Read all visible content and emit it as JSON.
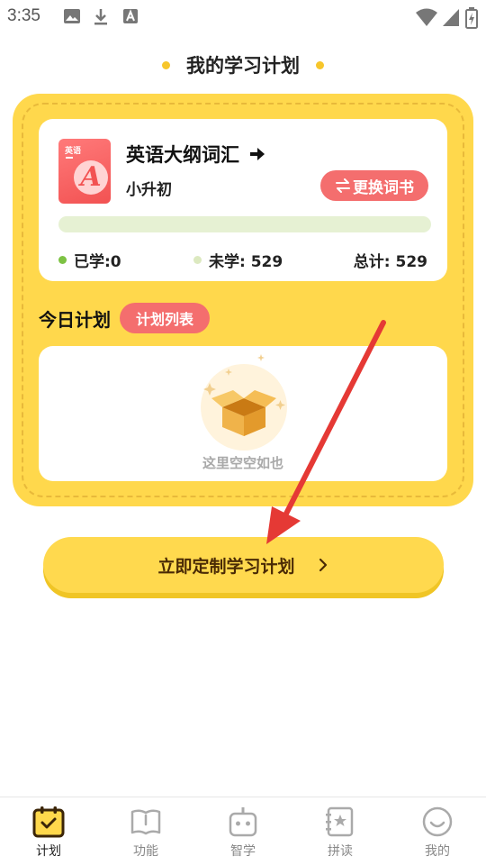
{
  "status_bar": {
    "time": "3:35"
  },
  "header": {
    "title": "我的学习计划"
  },
  "book": {
    "cover_label": "英语",
    "cover_letter": "A",
    "name": "英语大纲词汇",
    "level": "小升初",
    "change_label": "更换词书",
    "progress_fraction": 0,
    "learned": "已学:0",
    "unlearned": "未学: 529",
    "total": "总计: 529"
  },
  "today": {
    "title": "今日计划",
    "list_label": "计划列表",
    "empty_text": "这里空空如也"
  },
  "cta": {
    "label": "立即定制学习计划"
  },
  "nav": {
    "items": [
      {
        "label": "计划"
      },
      {
        "label": "功能"
      },
      {
        "label": "智学"
      },
      {
        "label": "拼读"
      },
      {
        "label": "我的"
      }
    ]
  },
  "colors": {
    "accent_yellow": "#ffd84c",
    "accent_red": "#f46e6e",
    "learned_dot": "#7dc243",
    "unlearned_dot": "#dce9c0",
    "annotation_arrow": "#e53935"
  }
}
